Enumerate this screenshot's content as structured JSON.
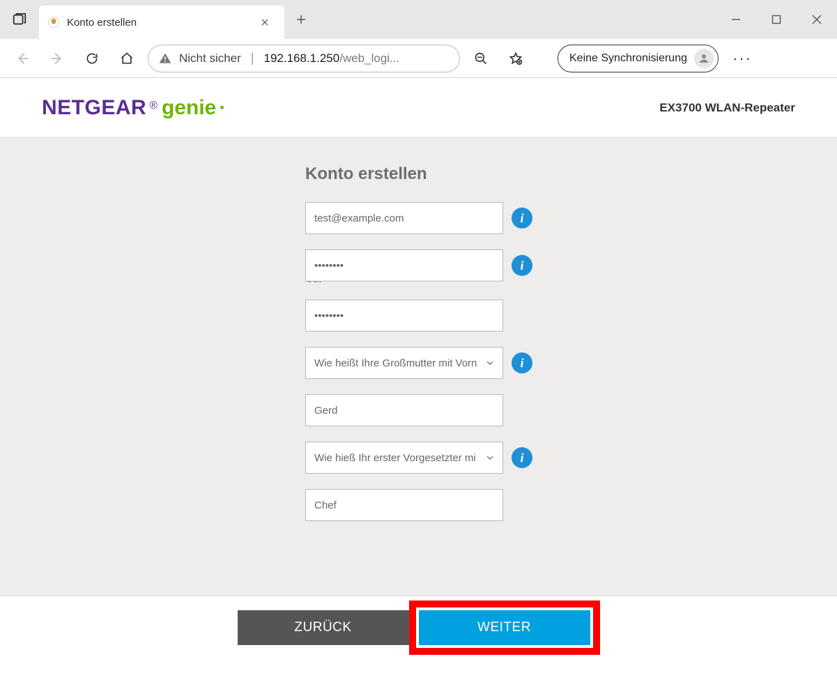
{
  "browser": {
    "tab_title": "Konto erstellen",
    "security_label": "Nicht sicher",
    "url_host": "192.168.1.250",
    "url_path": "/web_logi...",
    "sync_label": "Keine Synchronisierung"
  },
  "header": {
    "logo_brand": "NETGEAR",
    "logo_sub": "genie",
    "device_name": "EX3700 WLAN-Repeater"
  },
  "form": {
    "title": "Konto erstellen",
    "email": "test@example.com",
    "password": "••••••••",
    "password_strength": "Gut",
    "password_confirm": "••••••••",
    "question1_selected": "Wie heißt Ihre Großmutter mit Vorn",
    "answer1": "Gerd",
    "question2_selected": "Wie hieß Ihr erster Vorgesetzter mi",
    "answer2": "Chef"
  },
  "buttons": {
    "back": "ZURÜCK",
    "next": "WEITER"
  },
  "colors": {
    "accent": "#00a1de",
    "highlight": "#ff0000",
    "brand_purple": "#5a2e91",
    "brand_green": "#6fb400"
  }
}
